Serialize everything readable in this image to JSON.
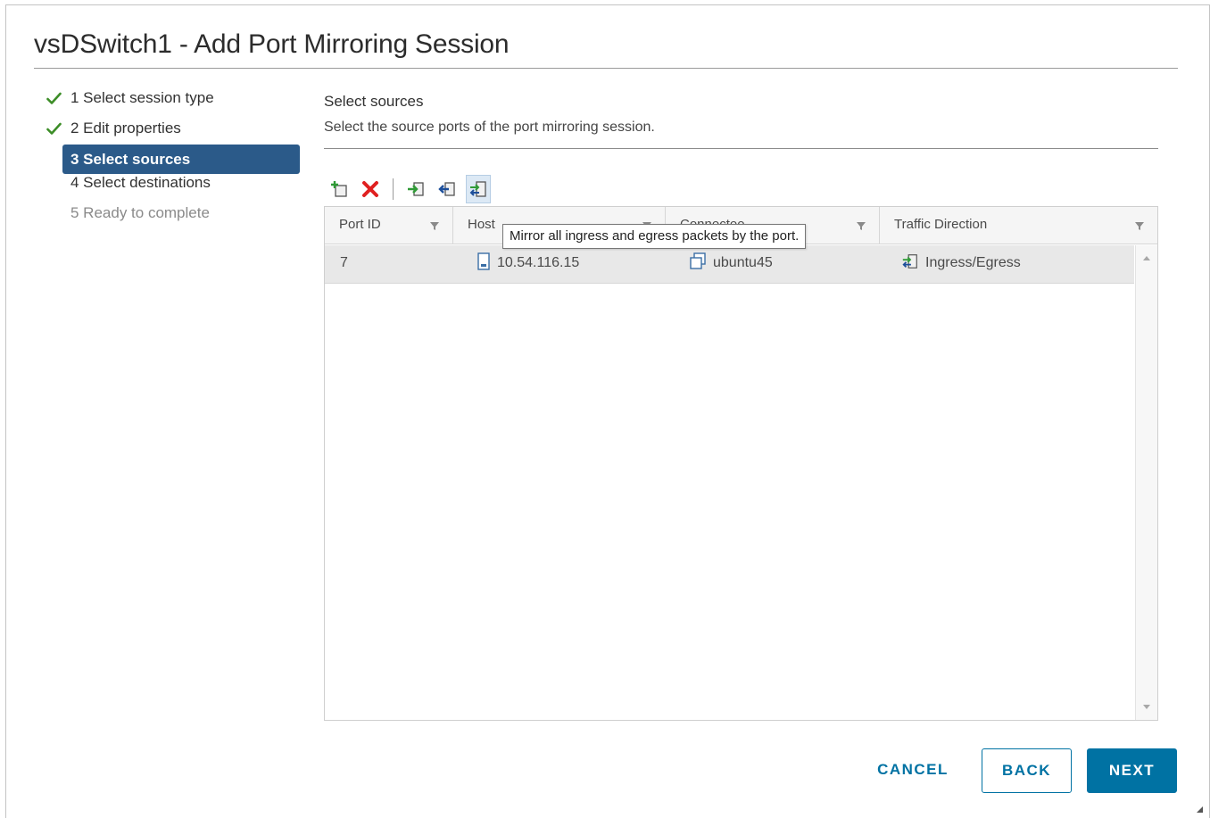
{
  "dialog": {
    "title": "vsDSwitch1 - Add Port Mirroring Session"
  },
  "steps": [
    {
      "label": "1 Select session type",
      "state": "completed"
    },
    {
      "label": "2 Edit properties",
      "state": "completed"
    },
    {
      "label": "3 Select sources",
      "state": "active"
    },
    {
      "label": "4 Select destinations",
      "state": "pending"
    },
    {
      "label": "5 Ready to complete",
      "state": "disabled"
    }
  ],
  "content": {
    "title": "Select sources",
    "subtitle": "Select the source ports of the port mirroring session."
  },
  "toolbar": {
    "buttons": [
      {
        "icon": "add-port-icon"
      },
      {
        "icon": "remove-icon"
      },
      {
        "icon": "ingress-icon"
      },
      {
        "icon": "egress-icon"
      },
      {
        "icon": "ingress-egress-icon",
        "selected": true
      }
    ]
  },
  "grid": {
    "columns": [
      "Port ID",
      "Host",
      "Connectee",
      "Traffic Direction"
    ],
    "rows": [
      {
        "port_id": "7",
        "host": "10.54.116.15",
        "connectee": "ubuntu45",
        "traffic_direction": "Ingress/Egress"
      }
    ]
  },
  "tooltip": {
    "text": "Mirror all ingress and egress packets by the port."
  },
  "footer": {
    "cancel": "CANCEL",
    "back": "BACK",
    "next": "NEXT"
  },
  "colors": {
    "accent": "#0072a3",
    "active_step_bg": "#2b5a89",
    "check_green": "#3c8d27",
    "remove_red": "#e02020"
  }
}
